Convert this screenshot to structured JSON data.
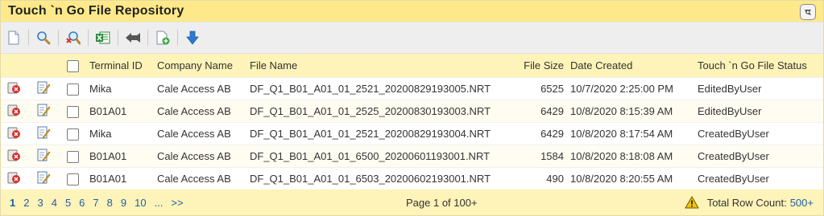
{
  "panel": {
    "title": "Touch `n Go File Repository"
  },
  "toolbar": {
    "buttons": [
      "new-document",
      "search",
      "clear-search",
      "export-excel",
      "import",
      "add-file",
      "download"
    ]
  },
  "table": {
    "headers": {
      "terminal_id": "Terminal ID",
      "company_name": "Company Name",
      "file_name": "File Name",
      "file_size": "File Size",
      "date_created": "Date Created",
      "status": "Touch `n Go File Status"
    },
    "rows": [
      {
        "terminal_id": "Mika",
        "company_name": "Cale Access AB",
        "file_name": "DF_Q1_B01_A01_01_2521_20200829193005.NRT",
        "file_size": "6525",
        "date_created": "10/7/2020 2:25:00 PM",
        "status": "EditedByUser"
      },
      {
        "terminal_id": "B01A01",
        "company_name": "Cale Access AB",
        "file_name": "DF_Q1_B01_A01_01_2525_20200830193003.NRT",
        "file_size": "6429",
        "date_created": "10/8/2020 8:15:39 AM",
        "status": "EditedByUser"
      },
      {
        "terminal_id": "Mika",
        "company_name": "Cale Access AB",
        "file_name": "DF_Q1_B01_A01_01_2521_20200829193004.NRT",
        "file_size": "6429",
        "date_created": "10/8/2020 8:17:54 AM",
        "status": "CreatedByUser"
      },
      {
        "terminal_id": "B01A01",
        "company_name": "Cale Access AB",
        "file_name": "DF_Q1_B01_A01_01_6500_20200601193001.NRT",
        "file_size": "1584",
        "date_created": "10/8/2020 8:18:08 AM",
        "status": "CreatedByUser"
      },
      {
        "terminal_id": "B01A01",
        "company_name": "Cale Access AB",
        "file_name": "DF_Q1_B01_A01_01_6503_20200602193001.NRT",
        "file_size": "490",
        "date_created": "10/8/2020 8:20:55 AM",
        "status": "CreatedByUser"
      }
    ]
  },
  "footer": {
    "pages": [
      "1",
      "2",
      "3",
      "4",
      "5",
      "6",
      "7",
      "8",
      "9",
      "10",
      "...",
      ">>"
    ],
    "current_page": "1",
    "page_info": "Page 1 of 100+",
    "row_count_label": "Total Row Count:",
    "row_count_value": "500+"
  },
  "colors": {
    "title_bg": "#fee98a",
    "header_bg": "#fef3b8",
    "link": "#1f5fa8"
  }
}
